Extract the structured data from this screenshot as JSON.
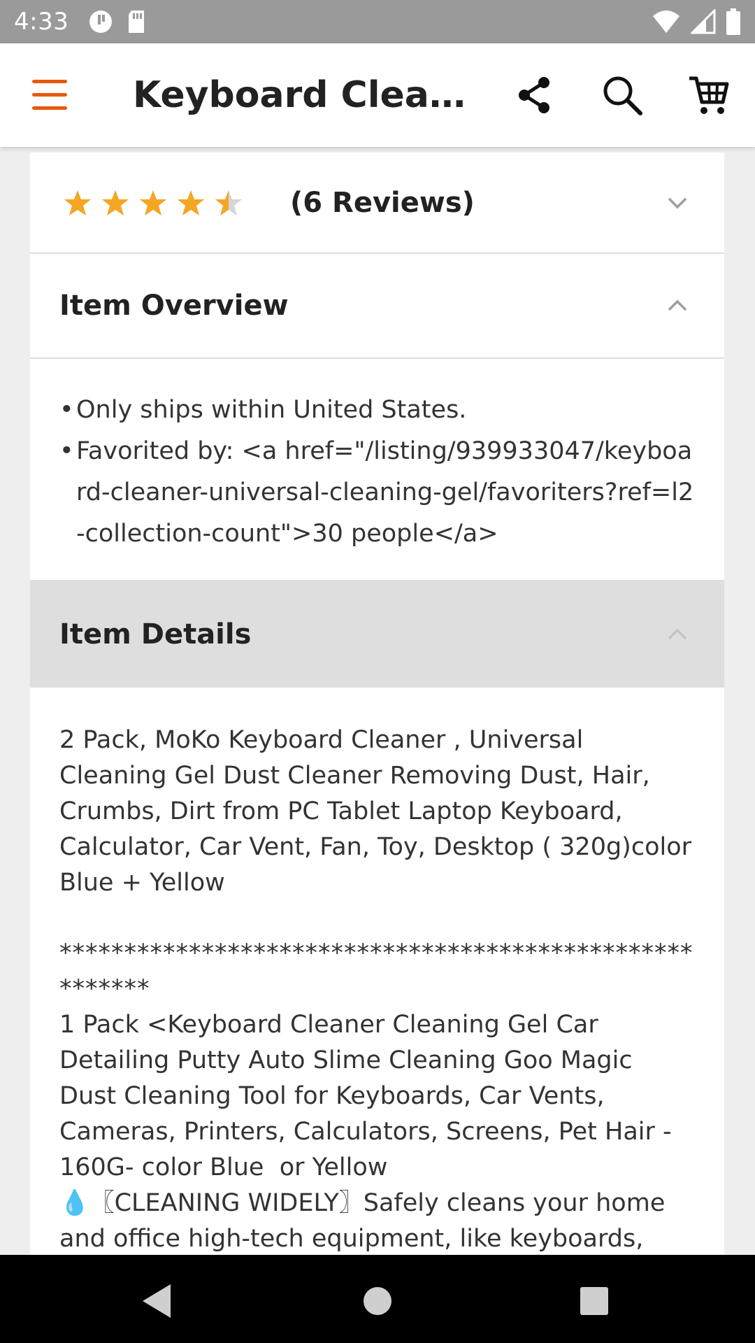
{
  "status_bar": {
    "time": "4:33",
    "left_icons": [
      "data-saver-icon",
      "sd-card-icon"
    ],
    "right_icons": [
      "wifi-icon",
      "signal-icon",
      "battery-icon"
    ]
  },
  "app_bar": {
    "title": "Keyboard Cleaner Universal Cleaning Gel",
    "accent_color": "#e8590c",
    "icons": [
      "menu-icon",
      "share-icon",
      "search-icon",
      "cart-icon"
    ]
  },
  "reviews": {
    "rating": 4.5,
    "max_rating": 5,
    "star_color": "#f5a623",
    "count_label": "(6 Reviews)"
  },
  "overview": {
    "title": "Item Overview",
    "bullets": [
      "Only ships within United States.",
      "Favorited by: <a href=\"/listing/939933047/keyboard-cleaner-universal-cleaning-gel/favoriters?ref=l2-collection-count\">30 people</a>"
    ]
  },
  "details": {
    "title": "Item Details",
    "paragraph_1": "2 Pack, MoKo Keyboard Cleaner , Universal Cleaning Gel Dust Cleaner Removing Dust, Hair, Crumbs, Dirt from PC Tablet Laptop Keyboard, Calculator, Car Vent, Fan, Toy, Desktop ( 320g)color  Blue + Yellow",
    "separator": "********************************************************",
    "paragraph_2": "1 Pack <Keyboard Cleaner Cleaning Gel Car Detailing Putty Auto Slime Cleaning Goo Magic Dust Cleaning Tool for Keyboards, Car Vents, Cameras, Printers, Calculators, Screens, Pet Hair - 160G- color Blue  or Yellow",
    "paragraph_3": "💧〖CLEANING WIDELY〗Safely cleans your home and office high-tech equipment, like keyboards,"
  },
  "nav_bar": {
    "icons": [
      "back-icon",
      "home-icon",
      "recents-icon"
    ]
  }
}
